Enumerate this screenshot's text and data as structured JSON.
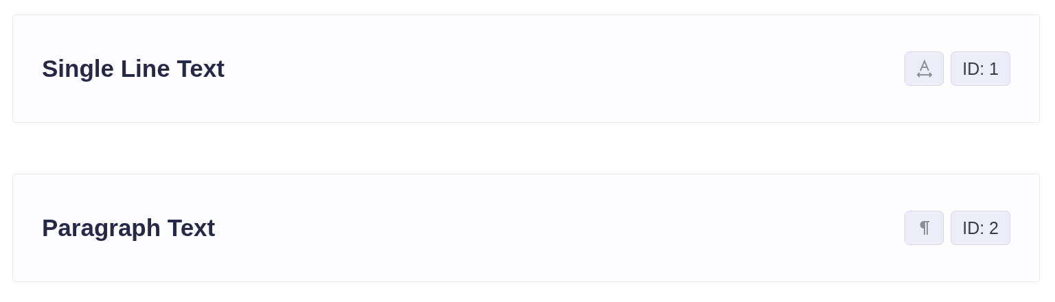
{
  "fields": [
    {
      "label": "Single Line Text",
      "kind": "text",
      "id_badge": "ID: 1"
    },
    {
      "label": "Paragraph Text",
      "kind": "paragraph",
      "id_badge": "ID: 2"
    }
  ]
}
